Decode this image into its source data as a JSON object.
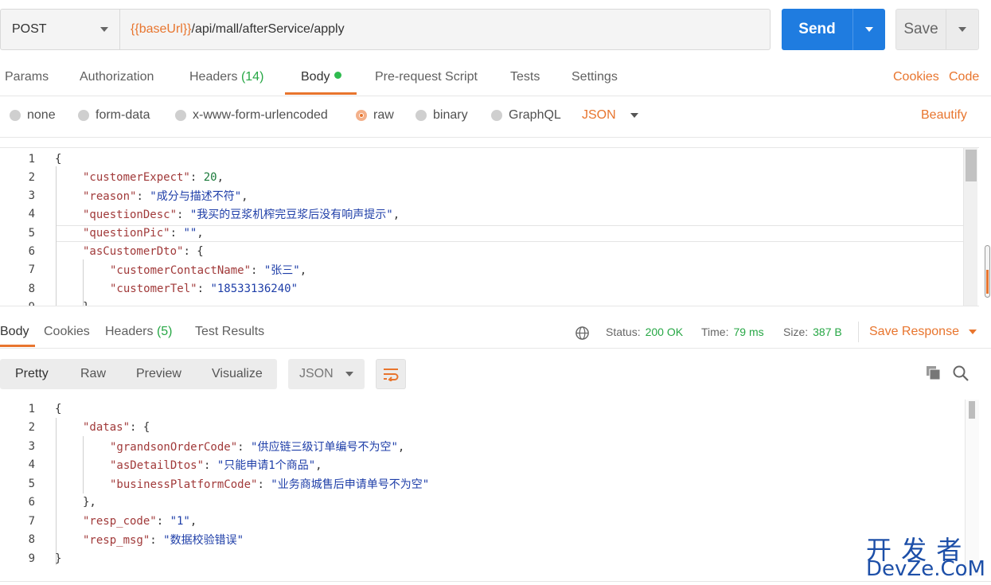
{
  "request": {
    "method": "POST",
    "url_var": "{{baseUrl}}",
    "url_path": "/api/mall/afterService/apply",
    "send_label": "Send",
    "save_label": "Save"
  },
  "request_tabs": {
    "params": "Params",
    "authorization": "Authorization",
    "headers": "Headers",
    "headers_count": "(14)",
    "body": "Body",
    "prerequest": "Pre-request Script",
    "tests": "Tests",
    "settings": "Settings",
    "cookies": "Cookies",
    "code": "Code"
  },
  "body_types": {
    "none": "none",
    "form_data": "form-data",
    "urlencoded": "x-www-form-urlencoded",
    "raw": "raw",
    "binary": "binary",
    "graphql": "GraphQL",
    "format": "JSON",
    "beautify": "Beautify"
  },
  "request_body_lines": [
    {
      "no": "1",
      "key": "",
      "val": "",
      "text": "{"
    },
    {
      "no": "2",
      "key": "\"customerExpect\"",
      "num": "20",
      "tail": ","
    },
    {
      "no": "3",
      "key": "\"reason\"",
      "val": "\"成分与描述不符\"",
      "tail": ","
    },
    {
      "no": "4",
      "key": "\"questionDesc\"",
      "val": "\"我买的豆浆机榨完豆浆后没有响声提示\"",
      "tail": ","
    },
    {
      "no": "5",
      "key": "\"questionPic\"",
      "val": "\"\"",
      "tail": ","
    },
    {
      "no": "6",
      "key": "\"asCustomerDto\"",
      "text": "{"
    },
    {
      "no": "7",
      "key": "\"customerContactName\"",
      "val": "\"张三\"",
      "tail": ","
    },
    {
      "no": "8",
      "key": "\"customerTel\"",
      "val": "\"18533136240\"",
      "tail": ""
    },
    {
      "no": "9",
      "text": "},"
    }
  ],
  "response_tabs": {
    "body": "Body",
    "cookies": "Cookies",
    "headers": "Headers",
    "headers_count": "(5)",
    "test_results": "Test Results"
  },
  "response_status": {
    "status_label": "Status:",
    "status_value": "200 OK",
    "time_label": "Time:",
    "time_value": "79 ms",
    "size_label": "Size:",
    "size_value": "387 B",
    "save_response": "Save Response"
  },
  "response_view": {
    "pretty": "Pretty",
    "raw": "Raw",
    "preview": "Preview",
    "visualize": "Visualize",
    "format": "JSON"
  },
  "response_body_lines": [
    {
      "no": "1",
      "text": "{"
    },
    {
      "no": "2",
      "key": "\"datas\"",
      "text": "{"
    },
    {
      "no": "3",
      "key": "\"grandsonOrderCode\"",
      "val": "\"供应链三级订单编号不为空\"",
      "tail": ","
    },
    {
      "no": "4",
      "key": "\"asDetailDtos\"",
      "val": "\"只能申请1个商品\"",
      "tail": ","
    },
    {
      "no": "5",
      "key": "\"businessPlatformCode\"",
      "val": "\"业务商城售后申请单号不为空\"",
      "tail": ""
    },
    {
      "no": "6",
      "text": "},"
    },
    {
      "no": "7",
      "key": "\"resp_code\"",
      "val": "\"1\"",
      "tail": ","
    },
    {
      "no": "8",
      "key": "\"resp_msg\"",
      "val": "\"数据校验错误\"",
      "tail": ""
    },
    {
      "no": "9",
      "text": "}"
    }
  ],
  "watermark": {
    "cn": "开 发 者",
    "en": "DevZe.CoM"
  },
  "colors": {
    "accent": "#e8752e",
    "send": "#1f7ce0",
    "success": "#27a745"
  }
}
